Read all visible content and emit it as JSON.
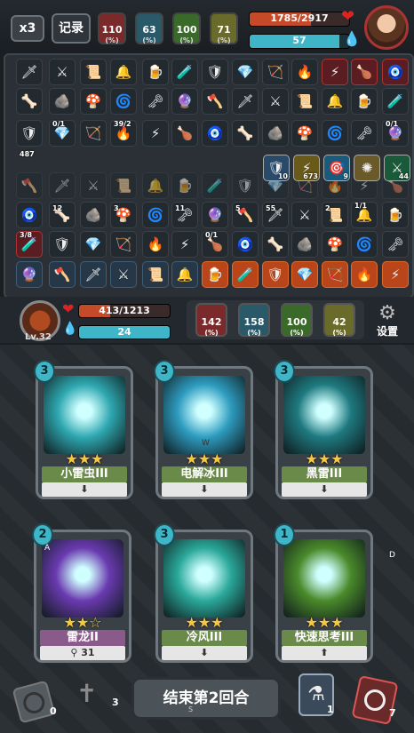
{
  "top": {
    "speed_label": "x3",
    "record_label": "记录",
    "stats": [
      {
        "value": "110",
        "unit": "(%)",
        "color": "#7a2a2a"
      },
      {
        "value": "63",
        "unit": "(%)",
        "color": "#2a5a6a"
      },
      {
        "value": "100",
        "unit": "(%)",
        "color": "#3a6a2a"
      },
      {
        "value": "71",
        "unit": "(%)",
        "color": "#6a6a2a"
      }
    ],
    "enemy_hp_text": "1785/2917",
    "enemy_hp_fraction": 0.612,
    "enemy_mana_text": "57",
    "enemy_mana_fraction": 0.9
  },
  "inventory": {
    "counts": {
      "r3c1": "487",
      "r3c2": "0/1",
      "r3c4": "39/2",
      "r3c14": "0/1",
      "r4c10": "10",
      "r4c11": "673",
      "r4c12": "9",
      "r4c14": "44",
      "r5c2": "12",
      "r5c4": "3",
      "r5c6": "11",
      "r5c8": "5",
      "r5c9": "55",
      "r5c11": "2",
      "r6c12": "1/1",
      "r7c1": "3/8",
      "r7c7": "0/1"
    }
  },
  "player": {
    "level": "Lv.32",
    "hp_text": "413/1213",
    "hp_fraction": 0.34,
    "mana_text": "24",
    "mana_fraction": 1.0,
    "stats": [
      {
        "value": "142",
        "unit": "(%)",
        "color": "#7a2a2a"
      },
      {
        "value": "158",
        "unit": "(%)",
        "color": "#2a5a6a"
      },
      {
        "value": "100",
        "unit": "(%)",
        "color": "#3a6a2a"
      },
      {
        "value": "42",
        "unit": "(%)",
        "color": "#6a6a2a"
      }
    ],
    "settings_label": "设置"
  },
  "cards": [
    {
      "name": "小雷虫III",
      "cost": "3",
      "stars": 3,
      "footer": "",
      "art": "#2ea7b0"
    },
    {
      "name": "电解冰III",
      "cost": "3",
      "stars": 3,
      "footer": "",
      "art": "#2e9cc0"
    },
    {
      "name": "黑雷III",
      "cost": "3",
      "stars": 3,
      "footer": "",
      "art": "#1e7a80"
    },
    {
      "name": "雷龙II",
      "cost": "2",
      "stars": 2,
      "footer": "31",
      "art": "#6a3ab0"
    },
    {
      "name": "冷风III",
      "cost": "3",
      "stars": 3,
      "footer": "",
      "art": "#2aa89a"
    },
    {
      "name": "快速思考III",
      "cost": "1",
      "stars": 3,
      "footer": "",
      "art": "#4a8a2a"
    }
  ],
  "card_marks": {
    "a": "A",
    "d": "D",
    "w": "W",
    "s": "S"
  },
  "bottom": {
    "discard_count": "0",
    "grave_count": "3",
    "end_turn_label": "结束第2回合",
    "potion_count": "1",
    "deck_count": "7"
  }
}
